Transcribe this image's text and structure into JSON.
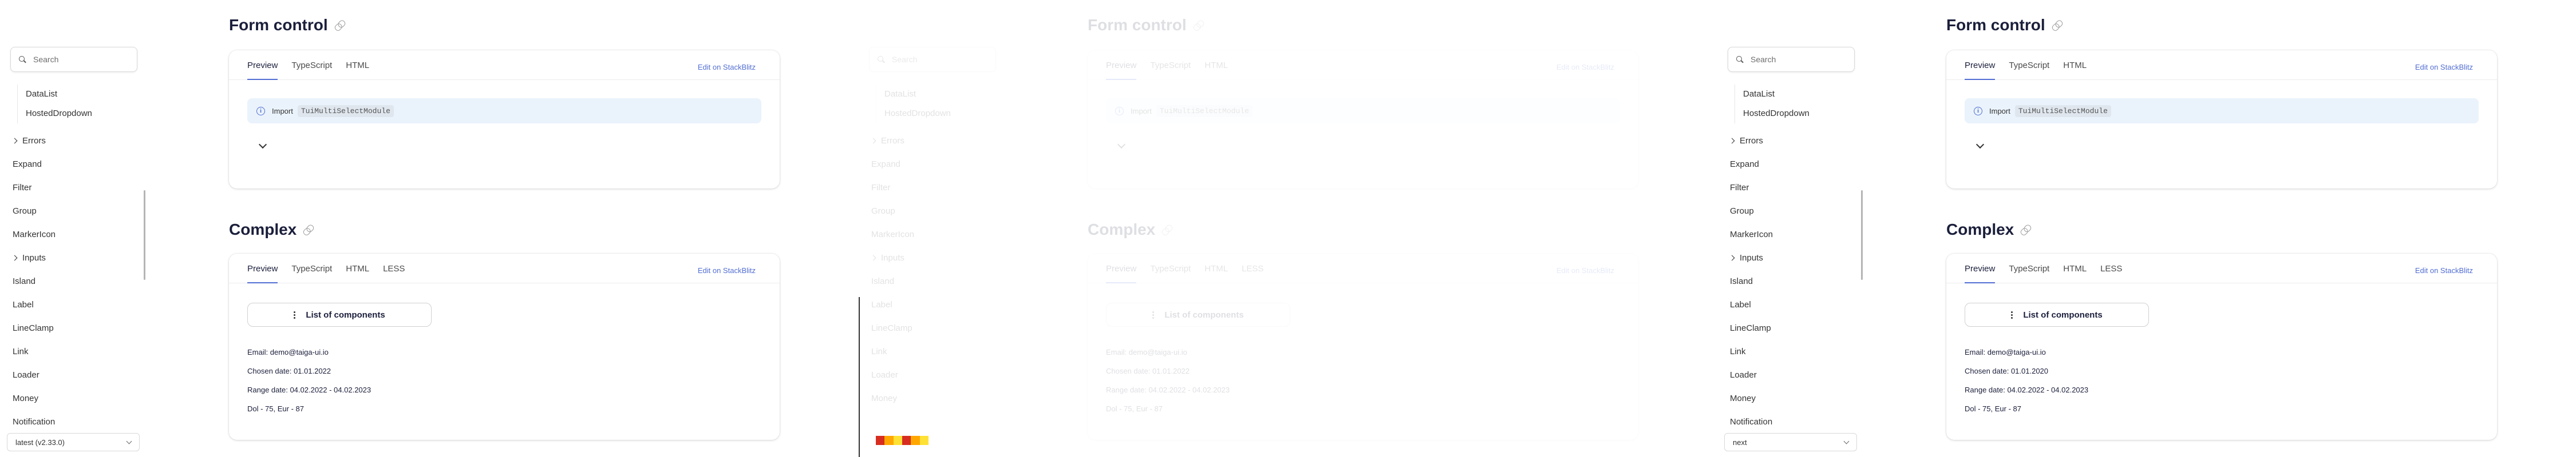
{
  "search": {
    "placeholder": "Search"
  },
  "sidebar": {
    "sub_items": [
      "DataList",
      "HostedDropdown"
    ],
    "items": [
      {
        "label": "Errors",
        "expandable": true
      },
      {
        "label": "Expand",
        "expandable": false
      },
      {
        "label": "Filter",
        "expandable": false
      },
      {
        "label": "Group",
        "expandable": false
      },
      {
        "label": "MarkerIcon",
        "expandable": false
      },
      {
        "label": "Inputs",
        "expandable": true
      },
      {
        "label": "Island",
        "expandable": false
      },
      {
        "label": "Label",
        "expandable": false
      },
      {
        "label": "LineClamp",
        "expandable": false
      },
      {
        "label": "Link",
        "expandable": false
      },
      {
        "label": "Loader",
        "expandable": false
      },
      {
        "label": "Money",
        "expandable": false
      },
      {
        "label": "Notification",
        "expandable": false
      }
    ]
  },
  "versions": {
    "first": "latest (v2.33.0)",
    "third": "next"
  },
  "form_control": {
    "title": "Form control",
    "tabs": [
      "Preview",
      "TypeScript",
      "HTML"
    ],
    "stackblitz": "Edit on StackBlitz",
    "import_label": "Import",
    "import_module": "TuiMultiSelectModule"
  },
  "complex": {
    "title": "Complex",
    "tabs": [
      "Preview",
      "TypeScript",
      "HTML",
      "LESS"
    ],
    "stackblitz": "Edit on StackBlitz",
    "button": "List of components",
    "lines_a": [
      "Email: demo@taiga-ui.io",
      "Chosen date: 01.01.2022",
      "Range date: 04.02.2022 - 04.02.2023",
      "Dol - 75, Eur - 87"
    ],
    "lines_b": [
      "Email: demo@taiga-ui.io",
      "Chosen date: 01.01.2020",
      "Range date: 04.02.2022 - 04.02.2023",
      "Dol - 75, Eur - 87"
    ]
  },
  "colors": {
    "accent": "#526ed3",
    "notice_bg": "#eaf3fc",
    "text": "#1b1f3b"
  }
}
